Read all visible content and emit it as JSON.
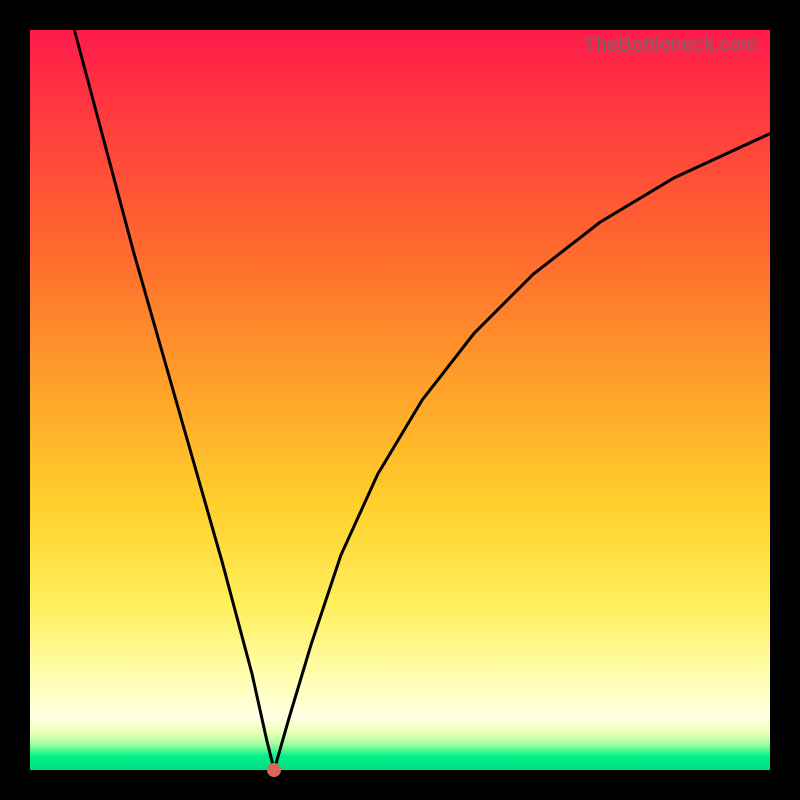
{
  "attribution": "TheBottleneck.com",
  "colors": {
    "page_bg": "#000000",
    "curve": "#000000",
    "marker": "#d9685c",
    "gradient_top": "#ff1b4a",
    "gradient_bottom": "#00e07f"
  },
  "chart_data": {
    "type": "line",
    "title": "",
    "xlabel": "",
    "ylabel": "",
    "xlim": [
      0,
      100
    ],
    "ylim": [
      0,
      100
    ],
    "grid": false,
    "legend": false,
    "series": [
      {
        "name": "left-branch",
        "x": [
          6,
          10,
          14,
          18,
          22,
          26,
          30,
          32,
          33
        ],
        "values": [
          100,
          85,
          70,
          56,
          42,
          28,
          13,
          4,
          0
        ]
      },
      {
        "name": "right-branch",
        "x": [
          33,
          35,
          38,
          42,
          47,
          53,
          60,
          68,
          77,
          87,
          100
        ],
        "values": [
          0,
          7,
          17,
          29,
          40,
          50,
          59,
          67,
          74,
          80,
          86
        ]
      }
    ],
    "marker": {
      "x": 33,
      "y": 0
    }
  }
}
